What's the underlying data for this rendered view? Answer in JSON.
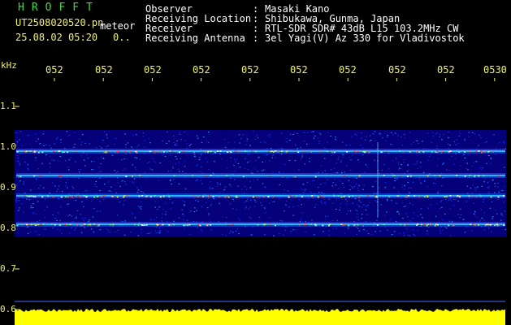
{
  "header": {
    "logo": "HROFFT",
    "filename": "UT2508020520.pn",
    "filename_suffix": "meteor",
    "datetime": "25.08.02 05:20",
    "datetime_suffix": "0..",
    "fields": [
      {
        "label": "Observer",
        "value": "Masaki Kano"
      },
      {
        "label": "Receiving Location",
        "value": "Shibukawa, Gunma, Japan"
      },
      {
        "label": "Receiver",
        "value": "RTL-SDR SDR# 43dB L15 103.2MHz CW"
      },
      {
        "label": "Receiving Antenna",
        "value": "3el Yagi(V) Az 330 for Vladivostok"
      }
    ]
  },
  "axis": {
    "y_unit": "kHz",
    "x_ticks": [
      "052",
      "052",
      "052",
      "052",
      "052",
      "052",
      "052",
      "052",
      "052",
      "0530"
    ],
    "y_ticks": [
      "1.1",
      "1.0",
      "0.9",
      "0.8",
      "0.7",
      "0.6"
    ]
  },
  "colors": {
    "background": "#000000",
    "logo": "#3fdc3f",
    "label_text": "#ffffff",
    "axis_text": "#f0f070",
    "spectrum_bg": "#05007a",
    "signal_level_bar": "#ffff00"
  },
  "spectrum": {
    "frequency_range_khz": [
      0.78,
      1.04
    ],
    "bands_khz": [
      0.99,
      0.93,
      0.88,
      0.81
    ]
  }
}
